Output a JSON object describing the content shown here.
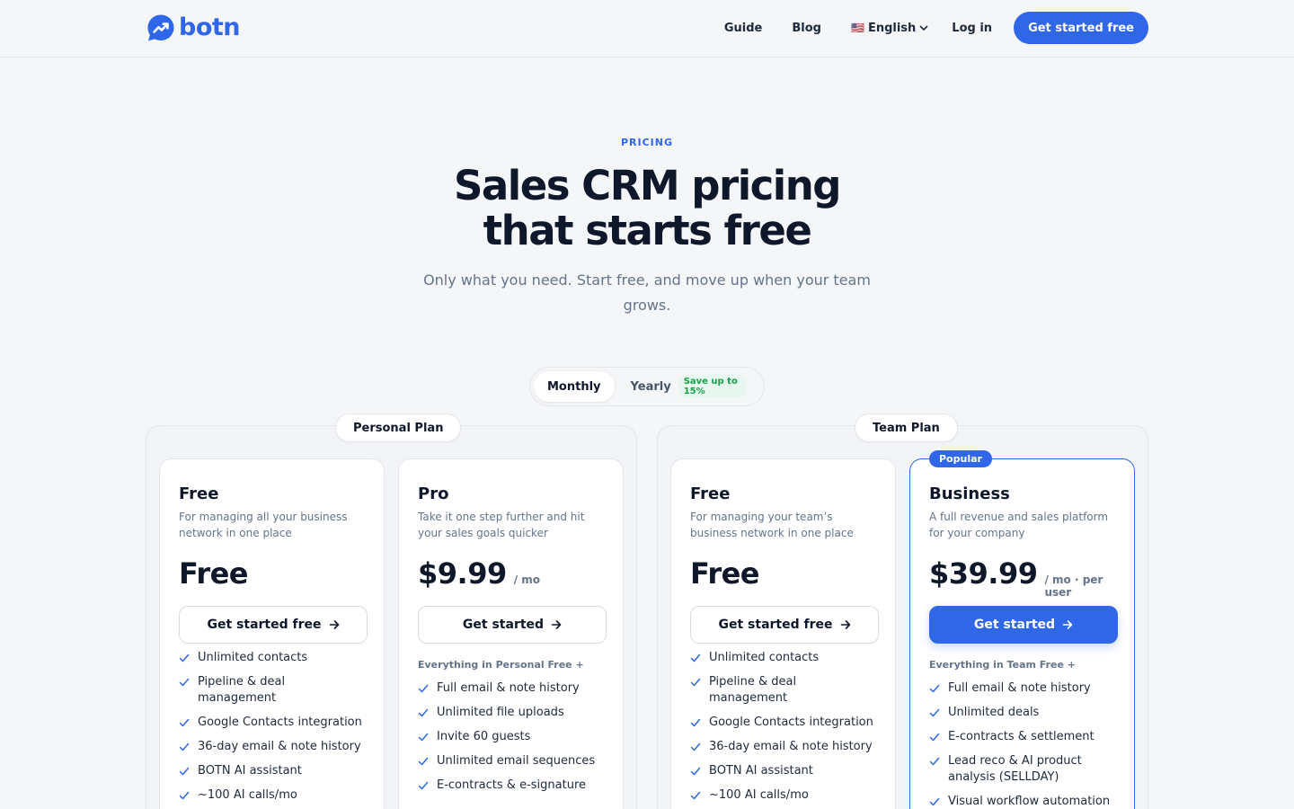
{
  "brand": {
    "name": "botn",
    "color": "#2f67e8"
  },
  "nav": {
    "guide": "Guide",
    "blog": "Blog",
    "language": {
      "flag": "🇺🇸",
      "label": "English"
    },
    "login": "Log in",
    "cta": "Get started free"
  },
  "hero": {
    "eyebrow": "PRICING",
    "title_line1": "Sales CRM pricing",
    "title_line2": "that starts free",
    "subtitle": "Only what you need. Start free, and move up when your team grows."
  },
  "billing_toggle": {
    "monthly": "Monthly",
    "yearly": "Yearly",
    "yearly_badge": "Save up to 15%",
    "selected": "Monthly"
  },
  "groups": {
    "personal": {
      "label": "Personal Plan"
    },
    "team": {
      "label": "Team Plan"
    }
  },
  "plans": [
    {
      "name": "Free",
      "description": "For managing all your business network in one place",
      "price": "Free",
      "price_unit": "",
      "cta": "Get started free",
      "includes": "",
      "features": [
        "Unlimited contacts",
        "Pipeline & deal management",
        "Google Contacts integration",
        "36-day email & note history",
        "BOTN AI assistant",
        "~100 AI calls/mo"
      ]
    },
    {
      "name": "Pro",
      "description": "Take it one step further and hit your sales goals quicker",
      "price": "$9.99",
      "price_unit": "/ mo",
      "cta": "Get started",
      "includes": "Everything in Personal Free +",
      "features": [
        "Full email & note history",
        "Unlimited file uploads",
        "Invite 60 guests",
        "Unlimited email sequences",
        "E-contracts & e-signature"
      ]
    },
    {
      "name": "Free",
      "description": "For managing your team’s business network in one place",
      "price": "Free",
      "price_unit": "",
      "cta": "Get started free",
      "includes": "",
      "features": [
        "Unlimited contacts",
        "Pipeline & deal management",
        "Google Contacts integration",
        "36-day email & note history",
        "BOTN AI assistant",
        "~100 AI calls/mo"
      ]
    },
    {
      "name": "Business",
      "badge": "Popular",
      "description": "A full revenue and sales platform for your company",
      "price": "$39.99",
      "price_unit": "/ mo · per user",
      "cta": "Get started",
      "includes": "Everything in Team Free +",
      "features": [
        "Full email & note history",
        "Unlimited deals",
        "E-contracts & settlement",
        "Lead reco & AI product analysis (SELLDAY)",
        "Visual workflow automation"
      ]
    }
  ]
}
